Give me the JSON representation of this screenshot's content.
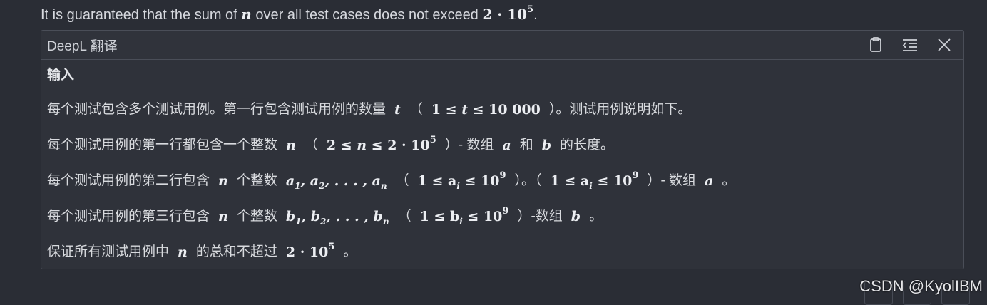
{
  "top_line": {
    "prefix": "It is guaranteed that the sum of",
    "var": "n",
    "middle": "over all test cases does not exceed",
    "bound_base": "2 · 10",
    "bound_exp": "5",
    "suffix": "."
  },
  "panel": {
    "title": "DeepL 翻译",
    "tools": [
      "clipboard-icon",
      "menu-collapse-icon",
      "close-icon"
    ]
  },
  "translation": {
    "heading": "输入",
    "p1": {
      "a": "每个测试包含多个测试用例。第一行包含测试用例的数量",
      "v": "t",
      "b": "（",
      "math": "1 ≤ ",
      "v2": "t",
      "math2": " ≤ 10 000",
      "c": "）。测试用例说明如下。"
    },
    "p2": {
      "a": "每个测试用例的第一行都包含一个整数",
      "v": "n",
      "b": "（",
      "math": "2 ≤ ",
      "v2": "n",
      "math2": " ≤ 2 · 10",
      "exp": "5",
      "c": "）- 数组",
      "v3": "a",
      "d": "和",
      "v4": "b",
      "e": "的长度。"
    },
    "p3": {
      "a": "每个测试用例的第二行包含",
      "v": "n",
      "b": "个整数",
      "seq": "a",
      "seq_sub1": "1",
      "seq_sep1": ", a",
      "seq_sub2": "2",
      "seq_mid": ", . . . , a",
      "seq_subn": "n",
      "c": "（",
      "m1": "1 ≤ a",
      "m1sub": "i",
      "m1b": " ≤ 10",
      "m1exp": "9",
      "d": "）。（",
      "m2": "1 ≤ a",
      "m2sub": "i",
      "m2b": " ≤ 10",
      "m2exp": "9",
      "e": "）- 数组",
      "v2": "a",
      "f": "。"
    },
    "p4": {
      "a": "每个测试用例的第三行包含",
      "v": "n",
      "b": "个整数",
      "seq": "b",
      "seq_sub1": "1",
      "seq_sep1": ", b",
      "seq_sub2": "2",
      "seq_mid": ", . . . , b",
      "seq_subn": "n",
      "c": "（",
      "m1": "1 ≤ b",
      "m1sub": "i",
      "m1b": " ≤ 10",
      "m1exp": "9",
      "d": "）-数组",
      "v2": "b",
      "e": "。"
    },
    "p5": {
      "a": "保证所有测试用例中",
      "v": "n",
      "b": "的总和不超过",
      "m": "2 · 10",
      "exp": "5",
      "c": "。"
    }
  },
  "watermark": "CSDN @KyolIBM"
}
